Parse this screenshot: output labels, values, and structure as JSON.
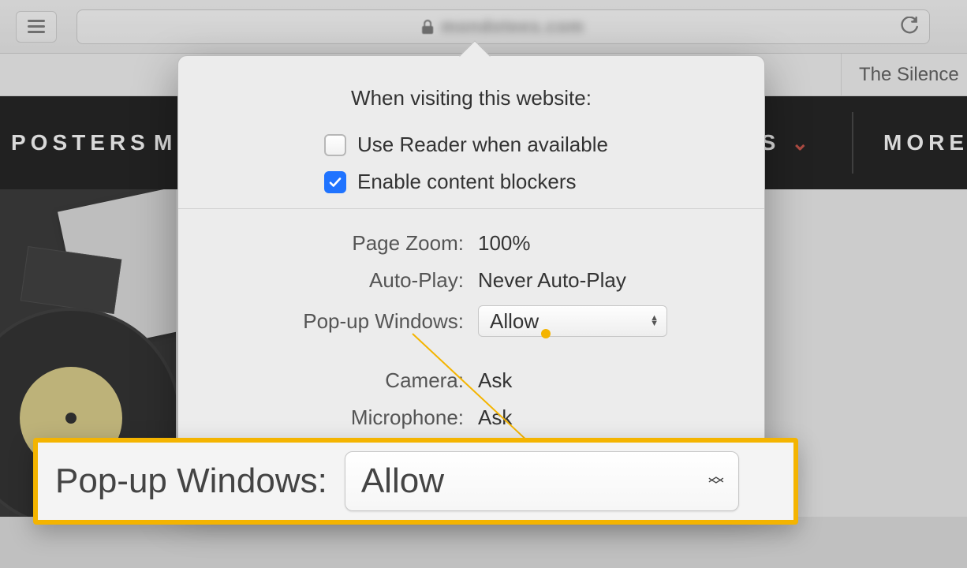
{
  "toolbar": {
    "url_host_blurred": "mondotees.com"
  },
  "tabs": {
    "right_tab_label": "The Silence"
  },
  "site_nav": {
    "item_posters": "POSTERS",
    "item_m_partial": "M",
    "item_es_partial": "ES",
    "item_more": "MORE"
  },
  "popover": {
    "title": "When visiting this website:",
    "check_reader_label": "Use Reader when available",
    "check_reader_checked": false,
    "check_blockers_label": "Enable content blockers",
    "check_blockers_checked": true,
    "rows1": {
      "page_zoom_label": "Page Zoom:",
      "page_zoom_value": "100%",
      "auto_play_label": "Auto-Play:",
      "auto_play_value": "Never Auto-Play",
      "popup_label": "Pop-up Windows:",
      "popup_value": "Allow"
    },
    "rows2": {
      "camera_label": "Camera:",
      "camera_value": "Ask",
      "microphone_label": "Microphone:",
      "microphone_value": "Ask"
    }
  },
  "callout": {
    "label": "Pop-up Windows:",
    "value": "Allow"
  }
}
